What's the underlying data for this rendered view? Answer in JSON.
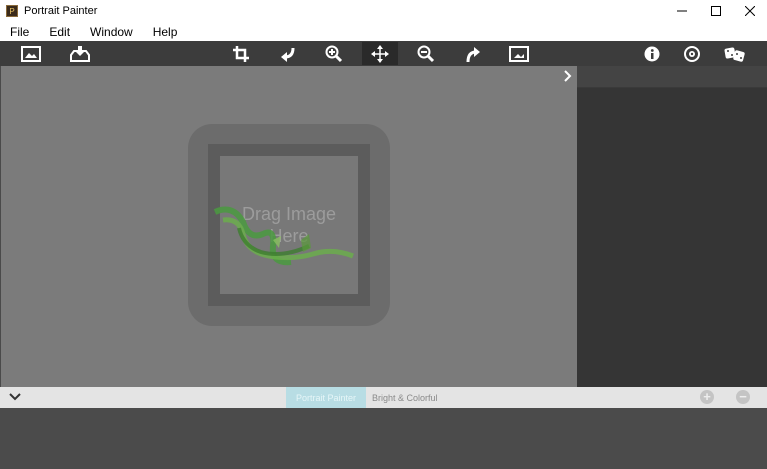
{
  "window": {
    "title": "Portrait Painter",
    "app_icon_glyph": "P",
    "controls": [
      "minimize-icon",
      "maximize-icon",
      "close-icon"
    ]
  },
  "menu": {
    "items": [
      "File",
      "Edit",
      "Window",
      "Help"
    ]
  },
  "toolbar": {
    "left_tools": [
      "open-image-icon",
      "save-image-icon"
    ],
    "center_tools": [
      "crop-icon",
      "undo-icon",
      "zoom-in-icon",
      "move-icon",
      "zoom-out-icon",
      "redo-icon",
      "fit-image-icon"
    ],
    "active_tool": "move-icon",
    "right_tools": [
      "info-icon",
      "settings-icon",
      "random-dice-icon"
    ]
  },
  "canvas": {
    "drop_prompt_line1": "Drag Image",
    "drop_prompt_line2": "Here",
    "watermark": "SOFTPEDIA style logo",
    "expand_icon": "chevron-right-icon"
  },
  "bottom": {
    "collapse_icon": "chevron-down-icon",
    "tabs": [
      {
        "label": "Portrait Painter",
        "active": true
      },
      {
        "label": "Bright & Colorful",
        "active": false
      }
    ],
    "add_label": "+",
    "remove_label": "−"
  },
  "colors": {
    "toolbar_bg": "#3c3c3c",
    "canvas_bg": "#7b7b7b",
    "panel_bg": "#353535",
    "active_tab": "#b8dde4"
  }
}
